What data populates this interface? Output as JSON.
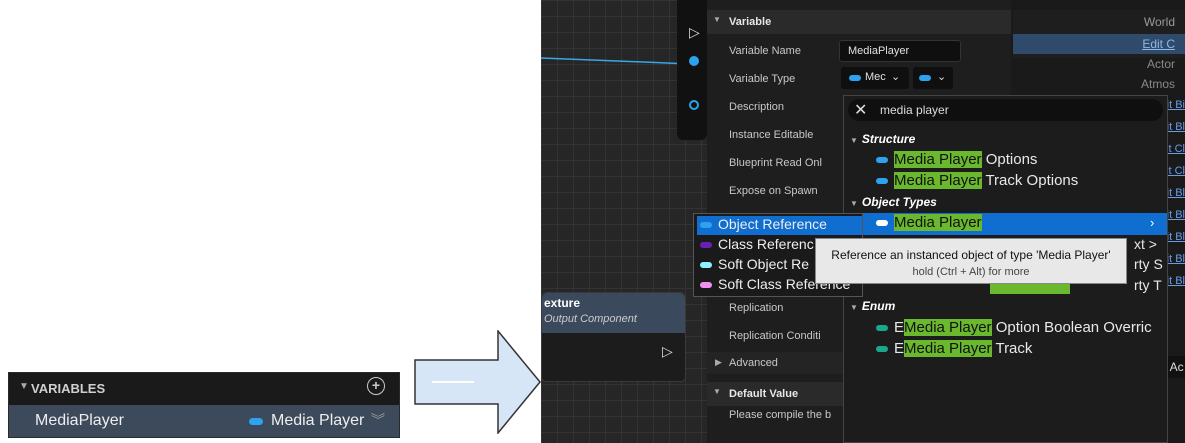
{
  "variables_panel": {
    "header": "VARIABLES",
    "add_icon": "plus-circle-icon",
    "variable": {
      "name": "MediaPlayer",
      "type": "Media Player",
      "type_color": "#2da3f0"
    }
  },
  "graph": {
    "node_title": "exture",
    "node_subtitle": "Output Component"
  },
  "details": {
    "variable_section": "Variable",
    "default_section": "Default Value",
    "props": {
      "variable_name": "Variable Name",
      "variable_name_value": "MediaPlayer",
      "variable_type": "Variable Type",
      "variable_type_value": "Mec",
      "description": "Description",
      "instance_editable": "Instance Editable",
      "blueprint_read": "Blueprint Read Onl",
      "expose_on_spawn": "Expose on Spawn",
      "replication": "Replication",
      "replication_condition": "Replication Conditi",
      "advanced": "Advanced",
      "compile_msg": "Please compile the b"
    }
  },
  "right_list": {
    "items": [
      "World",
      "Edit C",
      "Actor",
      "Atmos"
    ],
    "blue_items": [
      "it Bi",
      "it Bl",
      "it Cl",
      "it Cl",
      "it Bl",
      "it Bl",
      "it Bl",
      "it Bl",
      "it Bl"
    ],
    "bottom_item": "- Ac"
  },
  "type_picker": {
    "search_value": "media player",
    "categories": [
      {
        "name": "Structure",
        "items": [
          {
            "prefix": "",
            "match": "Media Player",
            "suffix": " Options",
            "color": "#2da3f0"
          },
          {
            "prefix": "",
            "match": "Media Player",
            "suffix": " Track Options",
            "color": "#2da3f0"
          }
        ]
      },
      {
        "name": "Object Types",
        "items": [
          {
            "prefix": "",
            "match": "Media Player",
            "suffix": "",
            "color": "#ffffff"
          }
        ]
      },
      {
        "name": "Enum",
        "items": [
          {
            "prefix": "E",
            "match": "Media Player",
            "suffix": " Option Boolean Overric",
            "color": "#1aa88c"
          },
          {
            "prefix": "E",
            "match": "Media Player",
            "suffix": " Track",
            "color": "#1aa88c"
          }
        ]
      }
    ],
    "partial_rows": [
      "xt >",
      "rty S",
      "rty T"
    ]
  },
  "reference_menu": {
    "items": [
      {
        "label": "Object Reference",
        "color": "#2da3f0"
      },
      {
        "label": "Class Referenc",
        "color": "#6a1fb8"
      },
      {
        "label": "Soft Object Re",
        "color": "#8ff0ff"
      },
      {
        "label": "Soft Class Reference",
        "color": "#f090f0"
      }
    ]
  },
  "tooltip": {
    "line1": "Reference an instanced object of type 'Media Player'",
    "line2": "hold (Ctrl + Alt) for more"
  }
}
